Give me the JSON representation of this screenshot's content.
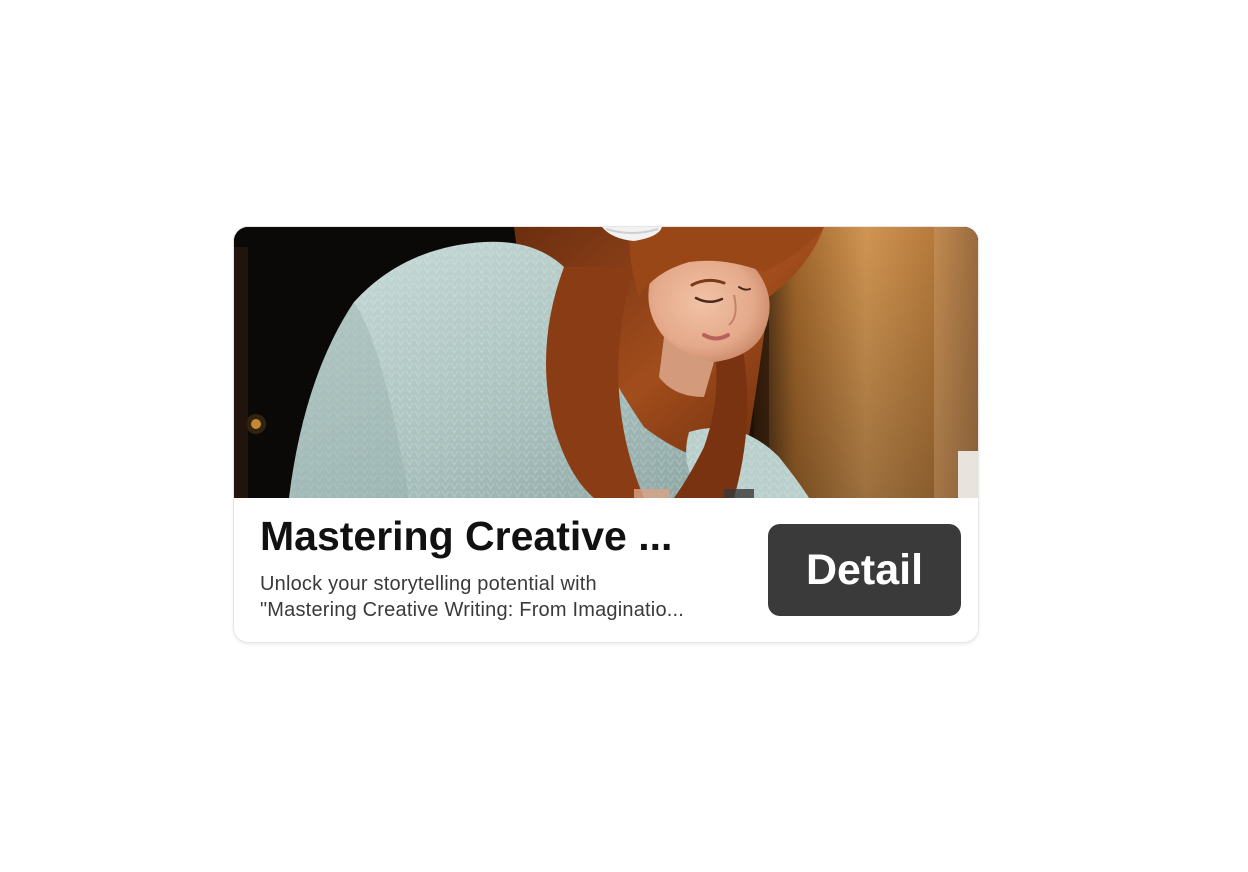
{
  "card": {
    "image_alt": "Woman with headphones writing at a desk",
    "title": "Mastering Creative ...",
    "description_line1": "Unlock your storytelling potential with",
    "description_line2": "\"Mastering Creative Writing: From Imaginatio...",
    "button_label": "Detail"
  },
  "colors": {
    "button_bg": "#3a3a3a",
    "button_text": "#ffffff",
    "title": "#111111",
    "description": "#3a3a3a"
  }
}
